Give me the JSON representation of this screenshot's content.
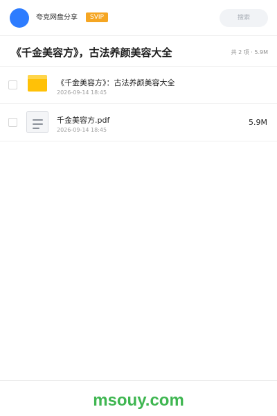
{
  "header": {
    "username": "夸克网盘分享",
    "badge": "SVIP",
    "search_placeholder": "搜索"
  },
  "share": {
    "title": "《千金美容方》，古法养颜美容大全",
    "summary": "共 2 项 · 5.9M"
  },
  "files": [
    {
      "icon": "folder-icon",
      "name": "《千金美容方》：古法养颜美容大全",
      "time": "2026-09-14 18:45",
      "size": ""
    },
    {
      "icon": "document-icon",
      "name": "千金美容方.pdf",
      "time": "2026-09-14 18:45",
      "size": "5.9M"
    }
  ],
  "footer": {
    "watermark": "msouy.com"
  },
  "colors": {
    "accent": "#2d7cff",
    "badge": "#f5a623",
    "folder": "#ffc107",
    "watermark": "#3fb651"
  }
}
